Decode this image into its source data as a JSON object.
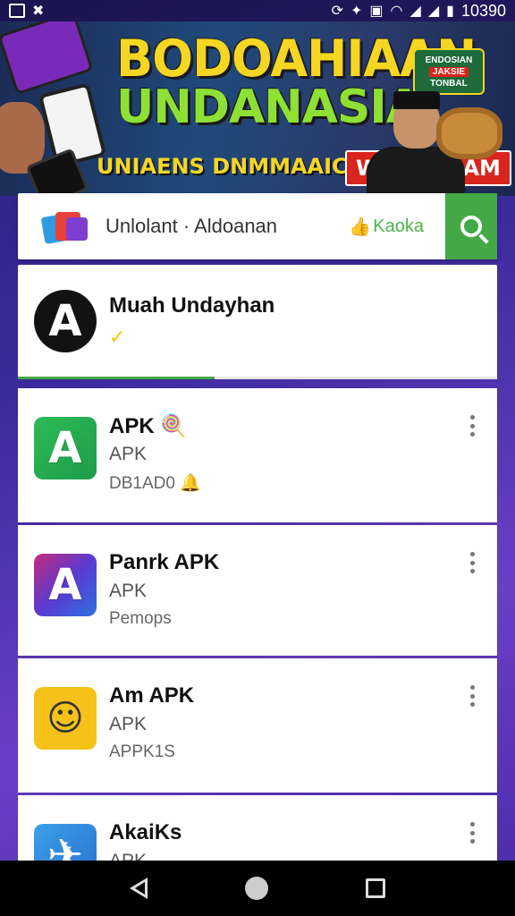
{
  "status_bar": {
    "time": "10390",
    "icons": [
      "image-icon",
      "close-icon",
      "sync-icon",
      "vibrate-icon",
      "nfc-icon",
      "wifi-icon",
      "signal-icon",
      "signal-icon",
      "battery-icon"
    ]
  },
  "banner": {
    "title_line1": "BODOAHIAAN",
    "title_line2": "UNDANASIA",
    "subtitle": "UNIAENS DNMMAAIC CORKO",
    "cta": "WNDNCLAM",
    "badge_top": "ENDOSIAN",
    "badge_mid": "JAKSIE",
    "badge_bottom": "TONBAL"
  },
  "search": {
    "text": "Unlolant · Aldoanan",
    "brand": "Kaoka",
    "brand_icon": "thumbs-up-icon",
    "button_icon": "search-icon"
  },
  "profile": {
    "name": "Muah Undayhan",
    "avatar_letter": "A",
    "badge_glyph": "✓",
    "progress_fraction": 0.41
  },
  "apps": [
    {
      "name": "APK",
      "name_suffix": "🍭",
      "type": "APK",
      "meta": "DB1AD0 🔔",
      "icon_letter": "A",
      "icon_style": "green"
    },
    {
      "name": "Panrk APK",
      "name_suffix": "",
      "type": "APK",
      "meta": "Pemops",
      "icon_letter": "A",
      "icon_style": "gradient"
    },
    {
      "name": "Am APK",
      "name_suffix": "",
      "type": "APK",
      "meta": "APPK1S",
      "icon_letter": "☺",
      "icon_style": "yellow"
    },
    {
      "name": "AkaiKs",
      "name_suffix": "",
      "type": "APK",
      "meta": "",
      "icon_letter": "✈",
      "icon_style": "blue"
    }
  ],
  "nav": {
    "back": "back-icon",
    "home": "home-icon",
    "recent": "recent-apps-icon"
  },
  "colors": {
    "accent_green": "#43a947",
    "banner_yellow": "#f5d623",
    "banner_green": "#8ee034",
    "cta_red": "#d9251d"
  }
}
